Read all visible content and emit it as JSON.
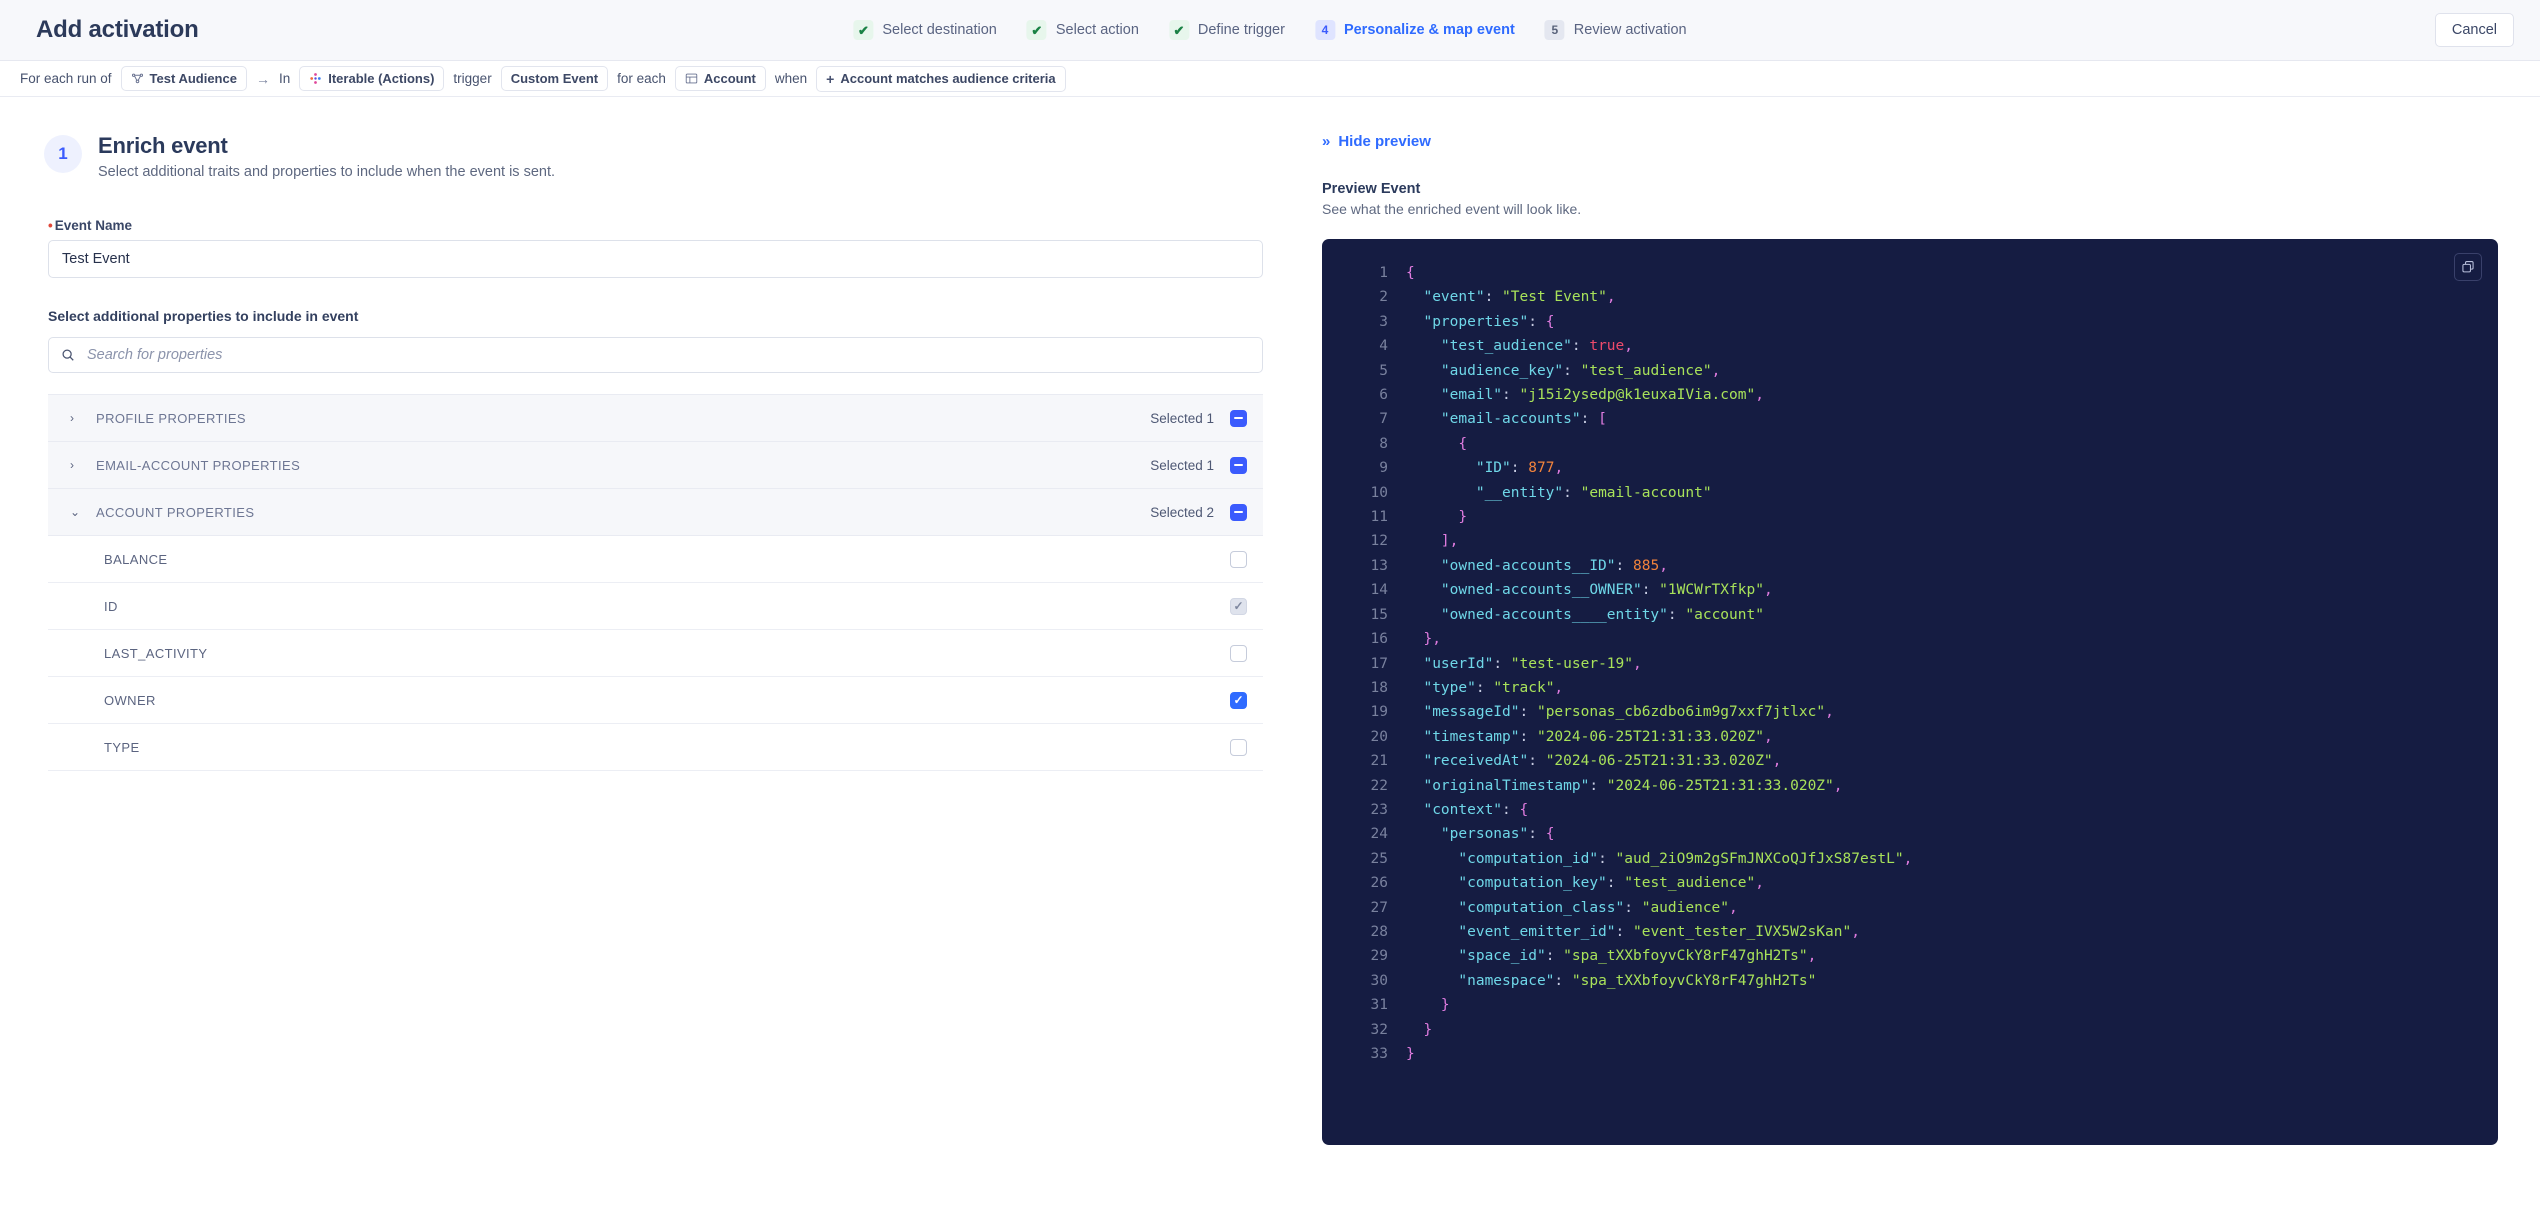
{
  "header": {
    "title": "Add activation",
    "cancel_label": "Cancel",
    "steps": [
      {
        "marker": "✔",
        "label": "Select destination",
        "state": "done"
      },
      {
        "marker": "✔",
        "label": "Select action",
        "state": "done"
      },
      {
        "marker": "✔",
        "label": "Define trigger",
        "state": "done"
      },
      {
        "marker": "4",
        "label": "Personalize & map event",
        "state": "active"
      },
      {
        "marker": "5",
        "label": "Review activation",
        "state": "upcoming"
      }
    ],
    "accent_color": "#2f6bff",
    "done_color": "#1a8245"
  },
  "breadcrumb": {
    "prefix": "For each run of",
    "audience_chip": "Test Audience",
    "arrow": "→",
    "in_word": "In",
    "destination_chip": "Iterable (Actions)",
    "trigger_word": "trigger",
    "event_chip": "Custom Event",
    "for_each_word": "for each",
    "entity_chip": "Account",
    "when_word": "when",
    "criteria_chip": "Account matches audience criteria",
    "criteria_plus": "+"
  },
  "section": {
    "number": "1",
    "title": "Enrich event",
    "subtitle": "Select additional traits and properties to include when the event is sent."
  },
  "event_name_field": {
    "label": "Event Name",
    "required_marker": "•",
    "value": "Test Event"
  },
  "properties": {
    "section_label": "Select additional properties to include in event",
    "search_placeholder": "Search for properties",
    "search_value": "",
    "groups": [
      {
        "name": "PROFILE PROPERTIES",
        "selected_label": "Selected 1",
        "expanded": false,
        "twisty": "›",
        "checkbox_state": "indeterminate",
        "items": []
      },
      {
        "name": "EMAIL-ACCOUNT PROPERTIES",
        "selected_label": "Selected 1",
        "expanded": false,
        "twisty": "›",
        "checkbox_state": "indeterminate",
        "items": []
      },
      {
        "name": "ACCOUNT PROPERTIES",
        "selected_label": "Selected 2",
        "expanded": true,
        "twisty": "⌄",
        "checkbox_state": "indeterminate",
        "items": [
          {
            "name": "BALANCE",
            "checkbox_state": "unchecked"
          },
          {
            "name": "ID",
            "checkbox_state": "checked-disabled"
          },
          {
            "name": "LAST_ACTIVITY",
            "checkbox_state": "unchecked"
          },
          {
            "name": "OWNER",
            "checkbox_state": "checked"
          },
          {
            "name": "TYPE",
            "checkbox_state": "unchecked"
          }
        ]
      }
    ]
  },
  "preview": {
    "toggle_label": "Hide preview",
    "toggle_glyph": "»",
    "title": "Preview Event",
    "subtitle": "See what the enriched event will look like.",
    "copy_icon": "copy-icon",
    "code_lines": [
      {
        "n": "1",
        "tokens": [
          {
            "t": "pun",
            "v": "{"
          }
        ]
      },
      {
        "n": "2",
        "tokens": [
          {
            "t": "key",
            "v": "  \"event\""
          },
          {
            "t": "pln",
            "v": ": "
          },
          {
            "t": "str",
            "v": "\"Test Event\""
          },
          {
            "t": "pun",
            "v": ","
          }
        ]
      },
      {
        "n": "3",
        "tokens": [
          {
            "t": "key",
            "v": "  \"properties\""
          },
          {
            "t": "pln",
            "v": ": "
          },
          {
            "t": "pun",
            "v": "{"
          }
        ]
      },
      {
        "n": "4",
        "tokens": [
          {
            "t": "key",
            "v": "    \"test_audience\""
          },
          {
            "t": "pln",
            "v": ": "
          },
          {
            "t": "bool",
            "v": "true"
          },
          {
            "t": "pun",
            "v": ","
          }
        ]
      },
      {
        "n": "5",
        "tokens": [
          {
            "t": "key",
            "v": "    \"audience_key\""
          },
          {
            "t": "pln",
            "v": ": "
          },
          {
            "t": "str",
            "v": "\"test_audience\""
          },
          {
            "t": "pun",
            "v": ","
          }
        ]
      },
      {
        "n": "6",
        "tokens": [
          {
            "t": "key",
            "v": "    \"email\""
          },
          {
            "t": "pln",
            "v": ": "
          },
          {
            "t": "str",
            "v": "\"j15i2ysedp@k1euxaIVia.com\""
          },
          {
            "t": "pun",
            "v": ","
          }
        ]
      },
      {
        "n": "7",
        "tokens": [
          {
            "t": "key",
            "v": "    \"email-accounts\""
          },
          {
            "t": "pln",
            "v": ": "
          },
          {
            "t": "pun",
            "v": "["
          }
        ]
      },
      {
        "n": "8",
        "tokens": [
          {
            "t": "pun",
            "v": "      {"
          }
        ]
      },
      {
        "n": "9",
        "tokens": [
          {
            "t": "key",
            "v": "        \"ID\""
          },
          {
            "t": "pln",
            "v": ": "
          },
          {
            "t": "num",
            "v": "877"
          },
          {
            "t": "pun",
            "v": ","
          }
        ]
      },
      {
        "n": "10",
        "tokens": [
          {
            "t": "key",
            "v": "        \"__entity\""
          },
          {
            "t": "pln",
            "v": ": "
          },
          {
            "t": "str",
            "v": "\"email-account\""
          }
        ]
      },
      {
        "n": "11",
        "tokens": [
          {
            "t": "pun",
            "v": "      }"
          }
        ]
      },
      {
        "n": "12",
        "tokens": [
          {
            "t": "pun",
            "v": "    ],"
          }
        ]
      },
      {
        "n": "13",
        "tokens": [
          {
            "t": "key",
            "v": "    \"owned-accounts__ID\""
          },
          {
            "t": "pln",
            "v": ": "
          },
          {
            "t": "num",
            "v": "885"
          },
          {
            "t": "pun",
            "v": ","
          }
        ]
      },
      {
        "n": "14",
        "tokens": [
          {
            "t": "key",
            "v": "    \"owned-accounts__OWNER\""
          },
          {
            "t": "pln",
            "v": ": "
          },
          {
            "t": "str",
            "v": "\"1WCWrTXfkp\""
          },
          {
            "t": "pun",
            "v": ","
          }
        ]
      },
      {
        "n": "15",
        "tokens": [
          {
            "t": "key",
            "v": "    \"owned-accounts____entity\""
          },
          {
            "t": "pln",
            "v": ": "
          },
          {
            "t": "str",
            "v": "\"account\""
          }
        ]
      },
      {
        "n": "16",
        "tokens": [
          {
            "t": "pun",
            "v": "  },"
          }
        ]
      },
      {
        "n": "17",
        "tokens": [
          {
            "t": "key",
            "v": "  \"userId\""
          },
          {
            "t": "pln",
            "v": ": "
          },
          {
            "t": "str",
            "v": "\"test-user-19\""
          },
          {
            "t": "pun",
            "v": ","
          }
        ]
      },
      {
        "n": "18",
        "tokens": [
          {
            "t": "key",
            "v": "  \"type\""
          },
          {
            "t": "pln",
            "v": ": "
          },
          {
            "t": "str",
            "v": "\"track\""
          },
          {
            "t": "pun",
            "v": ","
          }
        ]
      },
      {
        "n": "19",
        "tokens": [
          {
            "t": "key",
            "v": "  \"messageId\""
          },
          {
            "t": "pln",
            "v": ": "
          },
          {
            "t": "str",
            "v": "\"personas_cb6zdbo6im9g7xxf7jtlxc\""
          },
          {
            "t": "pun",
            "v": ","
          }
        ]
      },
      {
        "n": "20",
        "tokens": [
          {
            "t": "key",
            "v": "  \"timestamp\""
          },
          {
            "t": "pln",
            "v": ": "
          },
          {
            "t": "str",
            "v": "\"2024-06-25T21:31:33.020Z\""
          },
          {
            "t": "pun",
            "v": ","
          }
        ]
      },
      {
        "n": "21",
        "tokens": [
          {
            "t": "key",
            "v": "  \"receivedAt\""
          },
          {
            "t": "pln",
            "v": ": "
          },
          {
            "t": "str",
            "v": "\"2024-06-25T21:31:33.020Z\""
          },
          {
            "t": "pun",
            "v": ","
          }
        ]
      },
      {
        "n": "22",
        "tokens": [
          {
            "t": "key",
            "v": "  \"originalTimestamp\""
          },
          {
            "t": "pln",
            "v": ": "
          },
          {
            "t": "str",
            "v": "\"2024-06-25T21:31:33.020Z\""
          },
          {
            "t": "pun",
            "v": ","
          }
        ]
      },
      {
        "n": "23",
        "tokens": [
          {
            "t": "key",
            "v": "  \"context\""
          },
          {
            "t": "pln",
            "v": ": "
          },
          {
            "t": "pun",
            "v": "{"
          }
        ]
      },
      {
        "n": "24",
        "tokens": [
          {
            "t": "key",
            "v": "    \"personas\""
          },
          {
            "t": "pln",
            "v": ": "
          },
          {
            "t": "pun",
            "v": "{"
          }
        ]
      },
      {
        "n": "25",
        "tokens": [
          {
            "t": "key",
            "v": "      \"computation_id\""
          },
          {
            "t": "pln",
            "v": ": "
          },
          {
            "t": "str",
            "v": "\"aud_2iO9m2gSFmJNXCoQJfJxS87estL\""
          },
          {
            "t": "pun",
            "v": ","
          }
        ]
      },
      {
        "n": "26",
        "tokens": [
          {
            "t": "key",
            "v": "      \"computation_key\""
          },
          {
            "t": "pln",
            "v": ": "
          },
          {
            "t": "str",
            "v": "\"test_audience\""
          },
          {
            "t": "pun",
            "v": ","
          }
        ]
      },
      {
        "n": "27",
        "tokens": [
          {
            "t": "key",
            "v": "      \"computation_class\""
          },
          {
            "t": "pln",
            "v": ": "
          },
          {
            "t": "str",
            "v": "\"audience\""
          },
          {
            "t": "pun",
            "v": ","
          }
        ]
      },
      {
        "n": "28",
        "tokens": [
          {
            "t": "key",
            "v": "      \"event_emitter_id\""
          },
          {
            "t": "pln",
            "v": ": "
          },
          {
            "t": "str",
            "v": "\"event_tester_IVX5W2sKan\""
          },
          {
            "t": "pun",
            "v": ","
          }
        ]
      },
      {
        "n": "29",
        "tokens": [
          {
            "t": "key",
            "v": "      \"space_id\""
          },
          {
            "t": "pln",
            "v": ": "
          },
          {
            "t": "str",
            "v": "\"spa_tXXbfoyvCkY8rF47ghH2Ts\""
          },
          {
            "t": "pun",
            "v": ","
          }
        ]
      },
      {
        "n": "30",
        "tokens": [
          {
            "t": "key",
            "v": "      \"namespace\""
          },
          {
            "t": "pln",
            "v": ": "
          },
          {
            "t": "str",
            "v": "\"spa_tXXbfoyvCkY8rF47ghH2Ts\""
          }
        ]
      },
      {
        "n": "31",
        "tokens": [
          {
            "t": "pun",
            "v": "    }"
          }
        ]
      },
      {
        "n": "32",
        "tokens": [
          {
            "t": "pun",
            "v": "  }"
          }
        ]
      },
      {
        "n": "33",
        "tokens": [
          {
            "t": "pun",
            "v": "}"
          }
        ]
      }
    ]
  }
}
